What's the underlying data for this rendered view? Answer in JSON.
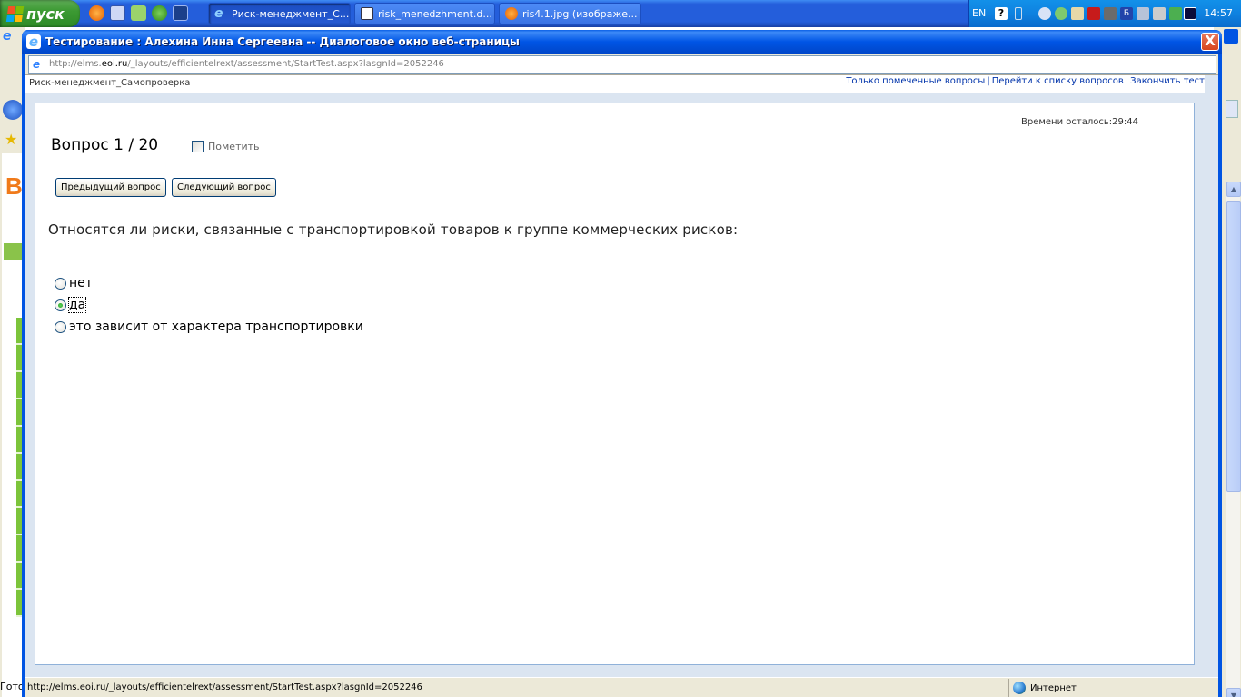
{
  "taskbar": {
    "start_label": "пуск",
    "tasks": [
      {
        "label": "Риск-менеджмент_С...",
        "active": true
      },
      {
        "label": "risk_menedzhment.d...",
        "active": false
      },
      {
        "label": "ris4.1.jpg (изображе...",
        "active": false
      }
    ],
    "language": "EN",
    "clock": "14:57"
  },
  "dialog": {
    "title": "Тестирование : Алехина Инна Сергеевна -- Диалоговое окно веб-страницы",
    "address_prefix": "http://elms.",
    "address_domain": "eoi.ru",
    "address_path": "/_layouts/efficientelrext/assessment/StartTest.aspx?lasgnId=2052246",
    "close_label": "X"
  },
  "test": {
    "name": "Риск-менеджмент_Самопроверка",
    "links": [
      "Только помеченные вопросы",
      "Перейти к списку вопросов",
      "Закончить тест"
    ],
    "timer": "Времени осталось:29:44",
    "question_number": "Вопрос 1 / 20",
    "mark_label": "Пометить",
    "prev_button": "Предыдущий вопрос",
    "next_button": "Следующий вопрос",
    "question_text": "Относятся ли риски, связанные с транспортировкой товаров к группе коммерческих рисков:",
    "options": [
      {
        "label": "нет",
        "selected": false
      },
      {
        "label": "да",
        "selected": true
      },
      {
        "label": "это зависит от характера транспортировки",
        "selected": false
      }
    ]
  },
  "status": {
    "url": "http://elms.eoi.ru/_layouts/efficientelrext/assessment/StartTest.aspx?lasgnId=2052246",
    "zone": "Интернет"
  },
  "background": {
    "status_partial": "Гото"
  }
}
